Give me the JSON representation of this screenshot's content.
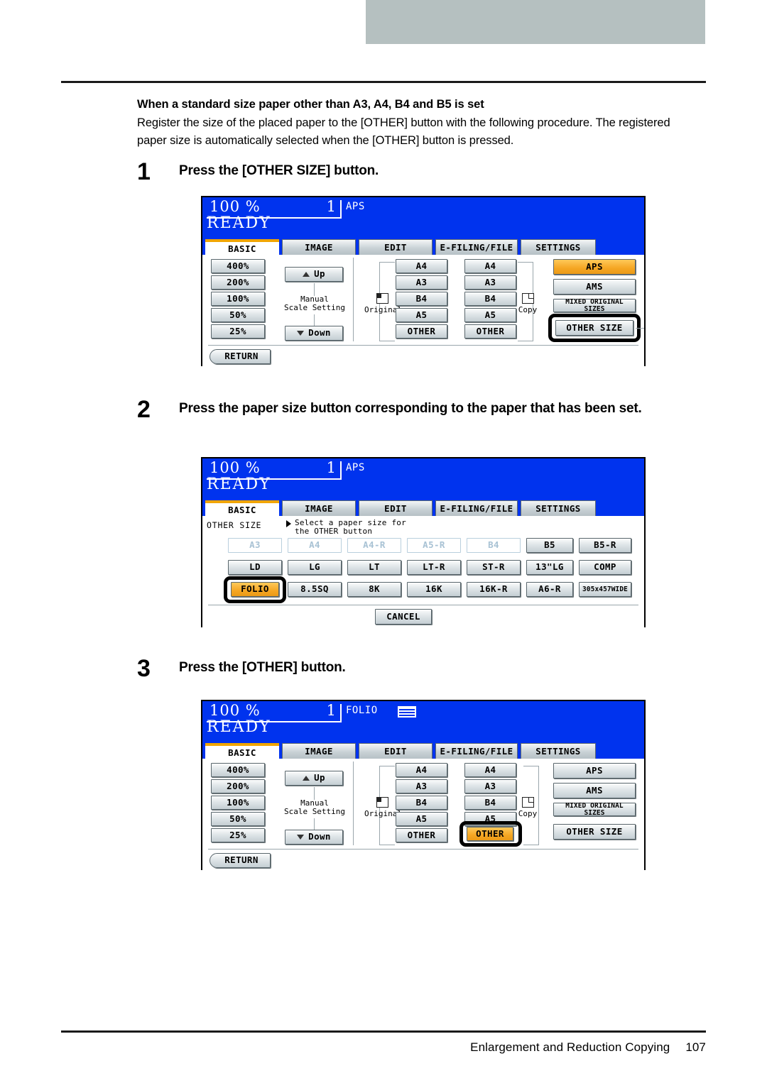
{
  "page": {
    "footer_title": "Enlargement and Reduction Copying",
    "footer_page": "107"
  },
  "section": {
    "heading": "When a standard size paper other than A3, A4, B4 and B5 is set",
    "paragraph": "Register the size of the placed paper to the [OTHER] button with the following procedure. The registered paper size is automatically selected when the [OTHER] button is pressed."
  },
  "steps": [
    {
      "number": "1",
      "text": "Press the [OTHER SIZE] button."
    },
    {
      "number": "2",
      "text": "Press the paper size button corresponding to the paper that has been set."
    },
    {
      "number": "3",
      "text": "Press the [OTHER] button."
    }
  ],
  "lcd_common": {
    "ratio": "100 %",
    "count": "1",
    "ready": "READY",
    "tabs": [
      {
        "label": "BASIC",
        "active": true
      },
      {
        "label": "IMAGE",
        "active": false
      },
      {
        "label": "EDIT",
        "active": false
      },
      {
        "label": "E-FILING/FILE",
        "active": false
      },
      {
        "label": "SETTINGS",
        "active": false
      }
    ],
    "zoom_buttons": [
      "400%",
      "200%",
      "100%",
      "50%",
      "25%"
    ],
    "up_label": "Up",
    "down_label": "Down",
    "manual_label_line1": "Manual",
    "manual_label_line2": "Scale Setting",
    "original_label": "Original",
    "copy_label": "Copy",
    "original_sizes": [
      "A4",
      "A3",
      "B4",
      "A5",
      "OTHER"
    ],
    "copy_sizes": [
      "A4",
      "A3",
      "B4",
      "A5",
      "OTHER"
    ],
    "right_buttons": [
      "APS",
      "AMS",
      "MIXED ORIGINAL SIZES",
      "OTHER SIZE"
    ],
    "return_label": "RETURN"
  },
  "lcd1": {
    "mode": "APS",
    "selected_right": "APS",
    "focused": "OTHER SIZE",
    "show_tray_icon": false
  },
  "lcd2": {
    "mode": "APS",
    "show_tray_icon": false,
    "title": "OTHER SIZE",
    "note_line1": "Select a paper size for",
    "note_line2": "the OTHER button",
    "cancel_label": "CANCEL",
    "selected_size": "FOLIO",
    "size_rows": [
      [
        {
          "label": "A3",
          "enabled": false
        },
        {
          "label": "A4",
          "enabled": false
        },
        {
          "label": "A4-R",
          "enabled": false
        },
        {
          "label": "A5-R",
          "enabled": false
        },
        {
          "label": "B4",
          "enabled": false
        },
        {
          "label": "B5",
          "enabled": true
        },
        {
          "label": "B5-R",
          "enabled": true
        }
      ],
      [
        {
          "label": "LD",
          "enabled": true
        },
        {
          "label": "LG",
          "enabled": true
        },
        {
          "label": "LT",
          "enabled": true
        },
        {
          "label": "LT-R",
          "enabled": true
        },
        {
          "label": "ST-R",
          "enabled": true
        },
        {
          "label": "13\"LG",
          "enabled": true
        },
        {
          "label": "COMP",
          "enabled": true
        }
      ],
      [
        {
          "label": "FOLIO",
          "enabled": true
        },
        {
          "label": "8.5SQ",
          "enabled": true
        },
        {
          "label": "8K",
          "enabled": true
        },
        {
          "label": "16K",
          "enabled": true
        },
        {
          "label": "16K-R",
          "enabled": true
        },
        {
          "label": "A6-R",
          "enabled": true
        },
        {
          "label": "305x457WIDE",
          "enabled": true
        }
      ]
    ]
  },
  "lcd3": {
    "mode": "FOLIO",
    "show_tray_icon": true,
    "selected_copy_size": "OTHER",
    "focused": "OTHER",
    "selected_right": ""
  },
  "colors": {
    "lcd_blue": "#0033ee",
    "accent_orange": "#f5a623",
    "header_gray": "#b5c0c0"
  }
}
